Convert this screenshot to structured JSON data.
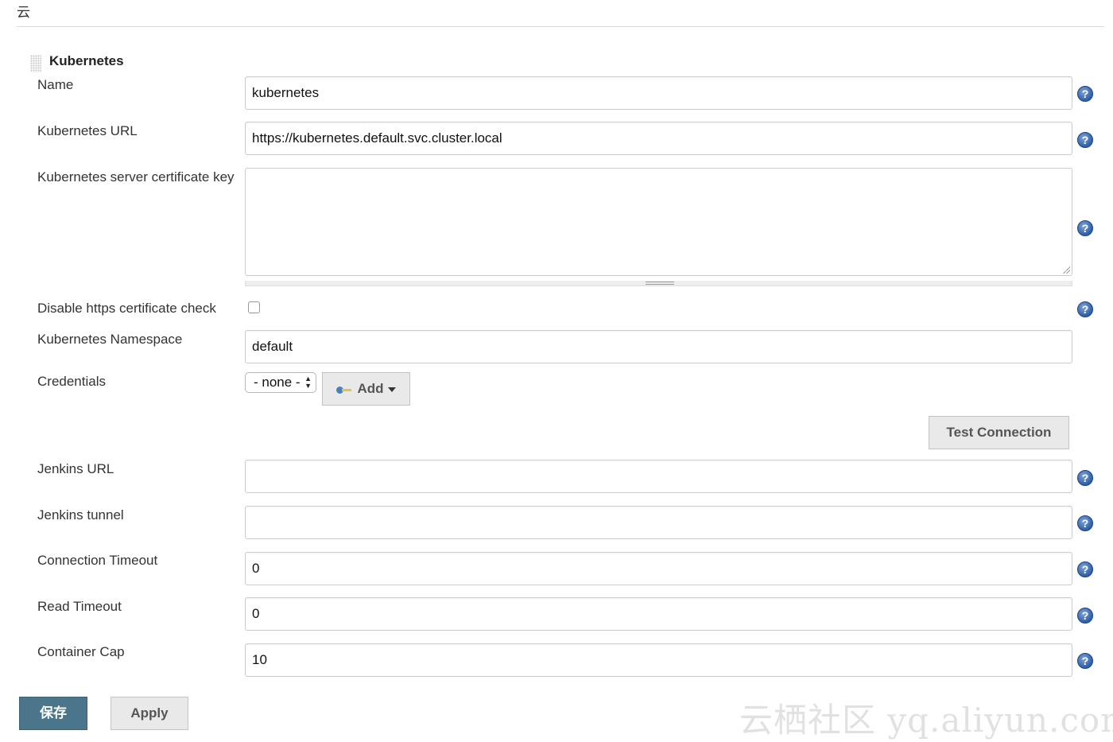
{
  "section": {
    "title": "云"
  },
  "cloud": {
    "title": "Kubernetes"
  },
  "fields": {
    "name": {
      "label": "Name",
      "value": "kubernetes"
    },
    "k8s_url": {
      "label": "Kubernetes URL",
      "value": "https://kubernetes.default.svc.cluster.local"
    },
    "cert_key": {
      "label": "Kubernetes server certificate key",
      "value": ""
    },
    "disable_https": {
      "label": "Disable https certificate check",
      "checked": false
    },
    "namespace": {
      "label": "Kubernetes Namespace",
      "value": "default"
    },
    "credentials": {
      "label": "Credentials",
      "selected": "- none -",
      "add_label": "Add"
    },
    "jenkins_url": {
      "label": "Jenkins URL",
      "value": ""
    },
    "jenkins_tunnel": {
      "label": "Jenkins tunnel",
      "value": ""
    },
    "conn_timeout": {
      "label": "Connection Timeout",
      "value": "0"
    },
    "read_timeout": {
      "label": "Read Timeout",
      "value": "0"
    },
    "container_cap": {
      "label": "Container Cap",
      "value": "10"
    }
  },
  "buttons": {
    "test_connection": "Test Connection",
    "save": "保存",
    "apply": "Apply"
  },
  "help_glyph": "?",
  "watermark": "云栖社区 yq.aliyun.com",
  "colors": {
    "save_button": "#4b758b",
    "help_icon": "#2f5fa8"
  }
}
